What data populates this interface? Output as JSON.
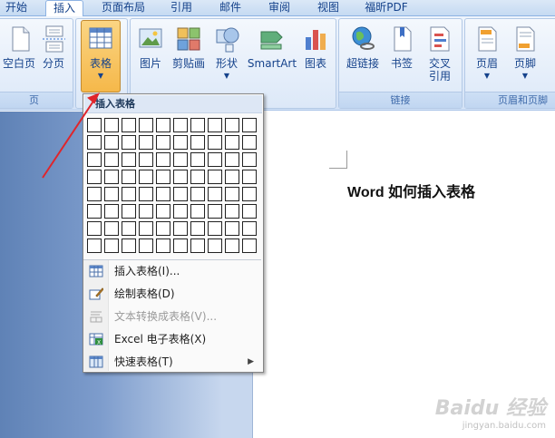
{
  "tabs": [
    {
      "label": "开始",
      "active": false
    },
    {
      "label": "插入",
      "active": true
    },
    {
      "label": "页面布局",
      "active": false
    },
    {
      "label": "引用",
      "active": false
    },
    {
      "label": "邮件",
      "active": false
    },
    {
      "label": "审阅",
      "active": false
    },
    {
      "label": "视图",
      "active": false
    },
    {
      "label": "福昕PDF",
      "active": false
    }
  ],
  "ribbon": {
    "pages_group": {
      "label": "页",
      "buttons": [
        "空白页",
        "分页"
      ]
    },
    "table_button": {
      "label": "表格"
    },
    "illustrations": {
      "buttons": [
        "图片",
        "剪贴画",
        "形状",
        "SmartArt",
        "图表"
      ]
    },
    "links_group": {
      "label": "链接",
      "buttons": [
        "超链接",
        "书签",
        "交叉\n引用"
      ]
    },
    "header_footer_group": {
      "label": "页眉和页脚",
      "buttons": [
        "页眉",
        "页脚"
      ]
    }
  },
  "dropdown": {
    "header": "插入表格",
    "grid": {
      "rows": 8,
      "cols": 10
    },
    "items": [
      {
        "label": "插入表格(I)...",
        "icon": "table-icon",
        "disabled": false
      },
      {
        "label": "绘制表格(D)",
        "icon": "pencil-table-icon",
        "disabled": false
      },
      {
        "label": "文本转换成表格(V)...",
        "icon": "text-to-table-icon",
        "disabled": true
      },
      {
        "label": "Excel 电子表格(X)",
        "icon": "excel-icon",
        "disabled": false
      },
      {
        "label": "快速表格(T)",
        "icon": "quick-table-icon",
        "disabled": false,
        "submenu": true
      }
    ]
  },
  "document": {
    "text": "Word 如何插入表格"
  },
  "watermark": {
    "logo": "Baidu 经验",
    "url": "jingyan.baidu.com"
  },
  "colors": {
    "accent": "#f5b84a",
    "ribbon_bg": "#dfeafa",
    "annotation": "#e0252b"
  }
}
